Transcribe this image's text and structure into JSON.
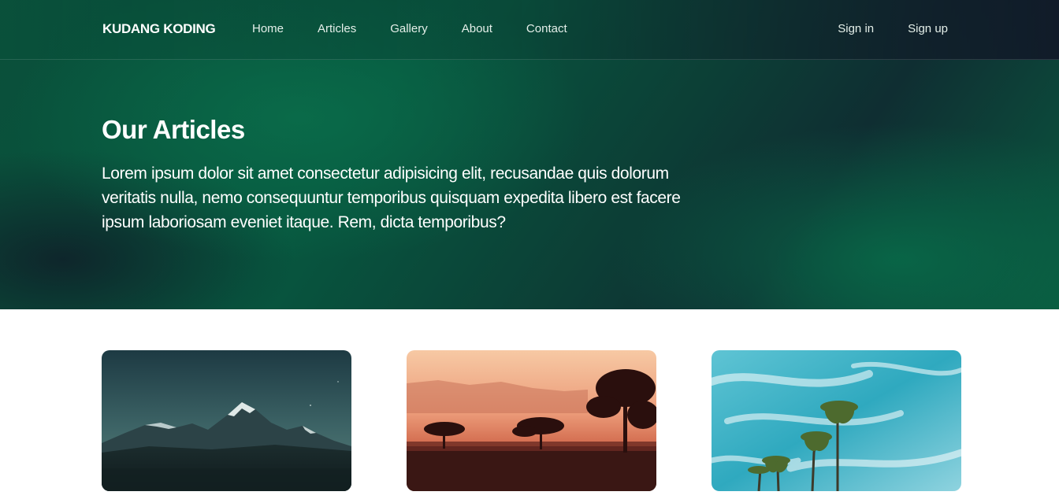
{
  "brand": {
    "name": "KUDANG KODING"
  },
  "nav": {
    "items": [
      {
        "label": "Home"
      },
      {
        "label": "Articles"
      },
      {
        "label": "Gallery"
      },
      {
        "label": "About"
      },
      {
        "label": "Contact"
      }
    ]
  },
  "auth": {
    "sign_in": "Sign in",
    "sign_up": "Sign up"
  },
  "hero": {
    "title": "Our Articles",
    "text": "Lorem ipsum dolor sit amet consectetur adipisicing elit, recusandae quis dolorum veritatis nulla, nemo consequuntur temporibus quisquam expedita libero est facere ipsum laboriosam eveniet itaque. Rem, dicta temporibus?"
  },
  "articles": [
    {
      "image": "mountain-night-image"
    },
    {
      "image": "savanna-sunset-image"
    },
    {
      "image": "palm-trees-sky-image"
    }
  ],
  "colors": {
    "hero_green": "#07573f",
    "hero_dark": "#0f2e32",
    "text_white": "#ffffff"
  }
}
